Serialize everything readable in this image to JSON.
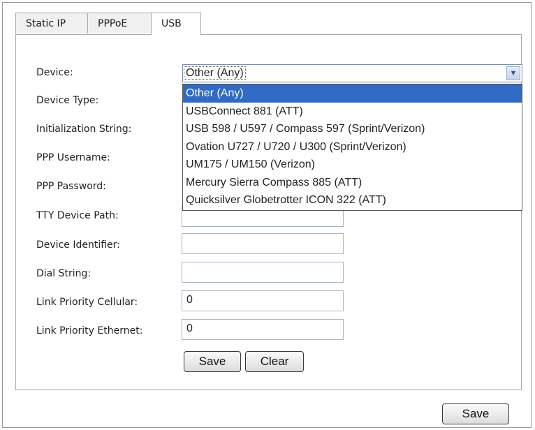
{
  "tabs": [
    "Static IP",
    "PPPoE",
    "USB"
  ],
  "form": {
    "labels": {
      "device": "Device:",
      "device_type": "Device Type:",
      "init_string": "Initialization String:",
      "ppp_username": "PPP Username:",
      "ppp_password": "PPP Password:",
      "tty_path": "TTY Device Path:",
      "device_identifier": "Device Identifier:",
      "dial_string": "Dial String:",
      "link_priority_cellular": "Link Priority Cellular:",
      "link_priority_ethernet": "Link Priority Ethernet:"
    },
    "device_selected": "Other (Any)",
    "device_options": [
      "Other (Any)",
      "USBConnect 881 (ATT)",
      "USB 598 / U597 / Compass 597 (Sprint/Verizon)",
      "Ovation U727 / U720 / U300 (Sprint/Verizon)",
      "UM175 / UM150 (Verizon)",
      "Mercury Sierra Compass 885 (ATT)",
      "Quicksilver Globetrotter ICON 322 (ATT)"
    ],
    "tty_path_value": "",
    "device_identifier_value": "",
    "dial_string_value": "",
    "link_priority_cellular_value": "0",
    "link_priority_ethernet_value": "0",
    "save_label": "Save",
    "clear_label": "Clear"
  },
  "footer": {
    "save_label": "Save"
  }
}
